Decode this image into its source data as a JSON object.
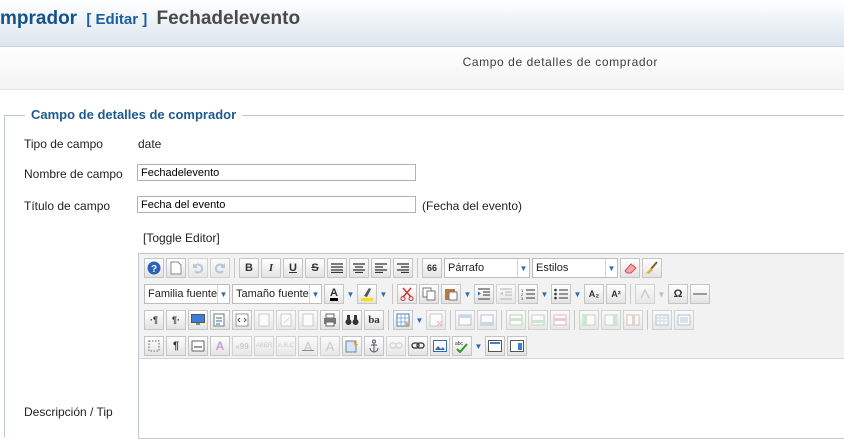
{
  "header": {
    "title_prefix": "mprador",
    "edit_link": "[ Editar ]",
    "field_name": "Fechadelevento"
  },
  "subheader": {
    "label": "Campo de detalles de comprador"
  },
  "fieldset": {
    "legend": "Campo de detalles de comprador"
  },
  "form": {
    "tipo_label": "Tipo de campo",
    "tipo_value": "date",
    "nombre_label": "Nombre de campo",
    "nombre_value": "Fechadelevento",
    "titulo_label": "Título de campo",
    "titulo_value": "Fecha del evento",
    "titulo_preview": "(Fecha del evento)",
    "toggle_editor": "[Toggle Editor]",
    "descripcion_label": "Descripción / Tip"
  },
  "editor": {
    "format_select": "Párrafo",
    "styles_select": "Estilos",
    "font_family_select": "Familia fuente",
    "font_size_select": "Tamaño fuente",
    "glyphs": {
      "bold": "B",
      "italic": "I",
      "underline": "U",
      "strike": "S",
      "blockquote": "66",
      "omega": "Ω",
      "subscript": "A₂",
      "superscript": "A²",
      "ltr": "·¶",
      "rtl": "¶·",
      "pilcrow": "¶",
      "font_color": "A",
      "cite": "«99",
      "abbr": "ABBR",
      "acronym": "A.B.C",
      "del": "A",
      "ins": "A",
      "case": "ba"
    }
  },
  "colors": {
    "brand_blue": "#15528a",
    "legend_blue": "#1e5a90",
    "accent_blue": "#2d6db3"
  }
}
